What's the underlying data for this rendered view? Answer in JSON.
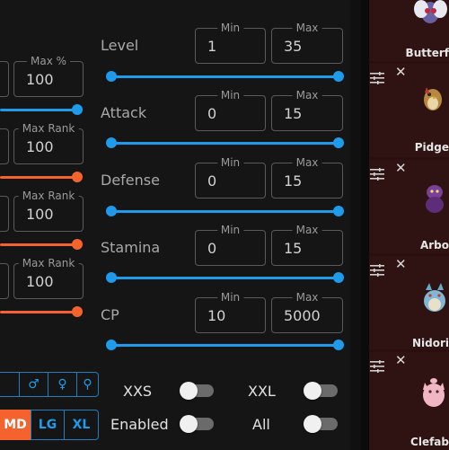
{
  "left_filters": [
    {
      "field_label": "Max %",
      "value": "100",
      "slider_color": "blue"
    },
    {
      "field_label": "Max Rank",
      "value": "100",
      "slider_color": "orange"
    },
    {
      "field_label": "Max Rank",
      "value": "100",
      "slider_color": "orange"
    },
    {
      "field_label": "Max Rank",
      "value": "100",
      "slider_color": "orange"
    }
  ],
  "stat_filters": [
    {
      "label": "Level",
      "min_label": "Min",
      "min": "1",
      "max_label": "Max",
      "max": "35"
    },
    {
      "label": "Attack",
      "min_label": "Min",
      "min": "0",
      "max_label": "Max",
      "max": "15"
    },
    {
      "label": "Defense",
      "min_label": "Min",
      "min": "0",
      "max_label": "Max",
      "max": "15"
    },
    {
      "label": "Stamina",
      "min_label": "Min",
      "min": "0",
      "max_label": "Max",
      "max": "15"
    },
    {
      "label": "CP",
      "min_label": "Min",
      "min": "10",
      "max_label": "Max",
      "max": "5000"
    }
  ],
  "gender_buttons": [
    "♂",
    "♀",
    "⚲"
  ],
  "size_buttons": [
    {
      "label": "MD",
      "selected": true
    },
    {
      "label": "LG",
      "selected": false
    },
    {
      "label": "XL",
      "selected": false
    }
  ],
  "toggles": [
    {
      "label": "XXS",
      "on": false
    },
    {
      "label": "XXL",
      "on": false
    },
    {
      "label": "Enabled",
      "on": false
    },
    {
      "label": "All",
      "on": false
    }
  ],
  "pokemon_cards": [
    {
      "name": "Butterf"
    },
    {
      "name": "Pidge"
    },
    {
      "name": "Arbo"
    },
    {
      "name": "Nidori"
    },
    {
      "name": "Clefab"
    }
  ],
  "colors": {
    "accent_blue": "#1e9bea",
    "accent_orange": "#f4622e",
    "card_bg": "#2f1212"
  }
}
